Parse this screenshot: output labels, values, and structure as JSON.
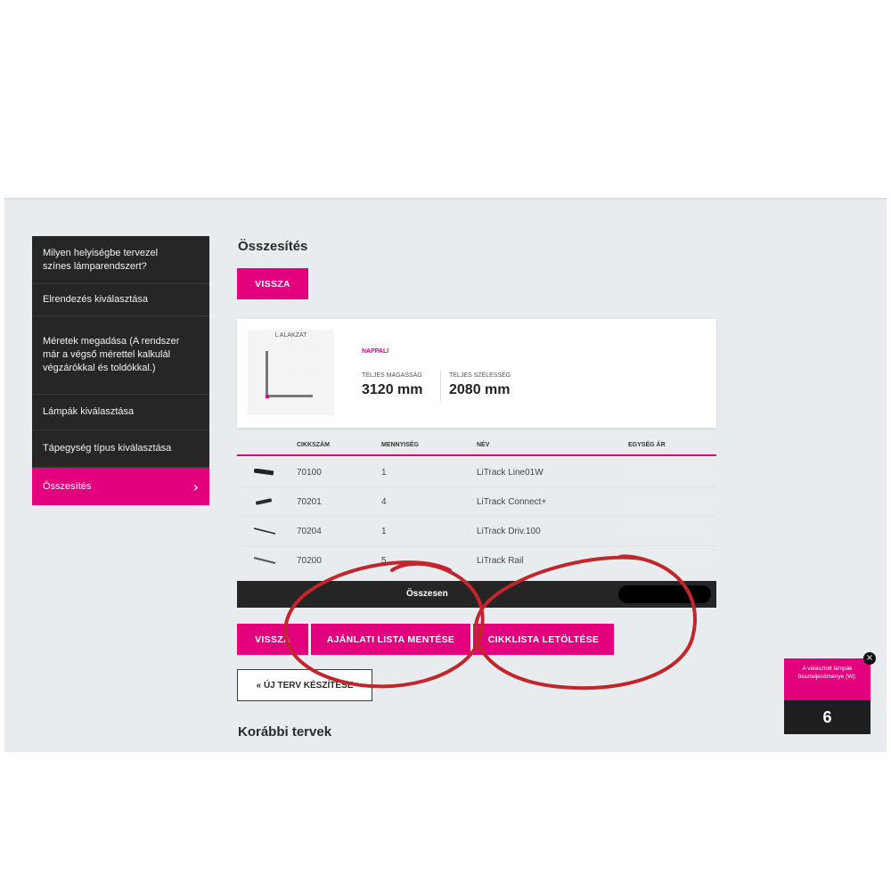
{
  "sidebar": {
    "items": [
      {
        "label": "Milyen helyiségbe tervezel színes lámparendszert?"
      },
      {
        "label": "Elrendezés kiválasztása"
      },
      {
        "label": "Méretek megadása (A rendszer már a végső mérettel kalkulál végzárókkal és toldókkal.)"
      },
      {
        "label": "Lámpák kiválasztása"
      },
      {
        "label": "Tápegység típus kiválasztása"
      },
      {
        "label": "Összesítés",
        "active": true,
        "icon": "chevron-right-icon"
      }
    ]
  },
  "main": {
    "title": "Összesítés",
    "back_button": "VISSZA",
    "summary": {
      "shape_label": "L ALAKZAT",
      "room": "NAPPALI",
      "height_label": "TELJES MAGASSÁG",
      "height_value": "3120 mm",
      "width_label": "TELJES SZÉLESSÉG",
      "width_value": "2080 mm"
    },
    "table": {
      "headers": [
        "CIKKSZÁM",
        "MENNYISÉG",
        "NÉV",
        "EGYSÉG ÁR"
      ],
      "rows": [
        {
          "sku": "70100",
          "qty": "1",
          "name": "LiTrack Line01W"
        },
        {
          "sku": "70201",
          "qty": "4",
          "name": "LiTrack Connect+"
        },
        {
          "sku": "70204",
          "qty": "1",
          "name": "LiTrack Driv.100"
        },
        {
          "sku": "70200",
          "qty": "5",
          "name": "LiTrack Rail"
        }
      ],
      "total_label": "Összesen"
    },
    "actions": {
      "back": "VISSZA",
      "save_quote": "AJÁNLATI LISTA MENTÉSE",
      "download_list": "CIKKLISTA LETÖLTÉSE",
      "new_plan": "« ÚJ TERV KÉSZÍTÉSE"
    },
    "previous_title": "Korábbi tervek"
  },
  "widget": {
    "label": "A választott lámpák összteljesítménye (W):",
    "value": "6"
  },
  "colors": {
    "accent": "#e3007d",
    "dark": "#262626",
    "annotation": "#c0262b",
    "background": "#e8ecef"
  }
}
